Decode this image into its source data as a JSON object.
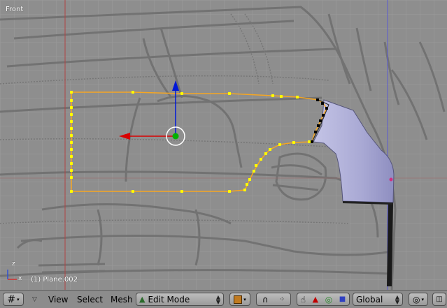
{
  "viewport": {
    "view_name": "Front",
    "object_info": "(1) Plane.002",
    "axis_labels": {
      "x": "x",
      "z": "z"
    }
  },
  "header": {
    "menus": {
      "view": "View",
      "select": "Select",
      "mesh": "Mesh"
    },
    "mode": "Edit Mode",
    "orientation": "Global"
  },
  "colors": {
    "grid_bg": "#8e8e8e",
    "grid_line": "#9a9a9a",
    "edge_selected": "#f5a623",
    "vertex_selected": "#ffff00",
    "vertex_unselected": "#000000",
    "manipulator_x": "#e00000",
    "manipulator_z": "#0020e0",
    "manipulator_center": "#00b000",
    "axis_x_line": "#b03030",
    "axis_z_line": "#5050c0"
  },
  "icons": {
    "view_type": "grid-icon",
    "collapse": "triangle-down-icon",
    "mode": "edit-mesh-icon",
    "draw_type": "solid-cube-icon",
    "pivot": "pivot-icon",
    "snap": "snap-icon",
    "hand": "hand-icon",
    "translate": "translate-triangle-icon",
    "rotate": "rotate-circle-icon",
    "scale": "scale-square-icon",
    "proportional": "proportional-icon"
  }
}
